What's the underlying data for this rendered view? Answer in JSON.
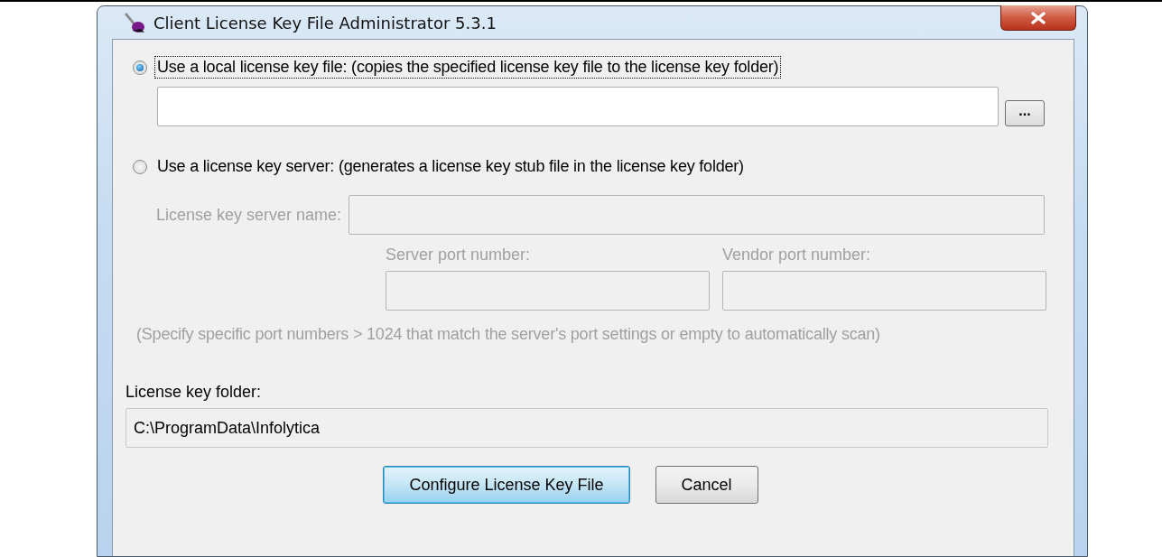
{
  "window": {
    "title": "Client License Key File Administrator 5.3.1"
  },
  "options": [
    {
      "label": "Use a local license key file: (copies the specified license key file to the license key folder)",
      "selected": true,
      "focused": true
    },
    {
      "label": "Use a license key server: (generates a license key stub file in the license key folder)",
      "selected": false,
      "focused": false
    }
  ],
  "local_file": {
    "browse_label": "..."
  },
  "server": {
    "name_label": "License key server name:",
    "server_port_label": "Server port number:",
    "vendor_port_label": "Vendor port number:",
    "note": "(Specify specific port numbers > 1024 that match the server's port settings or empty to automatically scan)"
  },
  "folder": {
    "label": "License key folder:",
    "value": "C:\\ProgramData\\Infolytica"
  },
  "buttons": [
    {
      "label": "Configure License Key File",
      "default": true
    },
    {
      "label": "Cancel",
      "default": false
    }
  ]
}
